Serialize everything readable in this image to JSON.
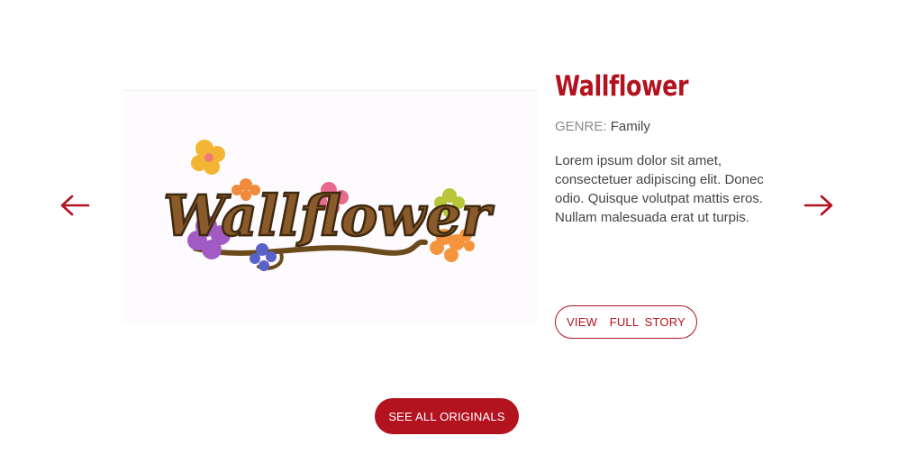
{
  "carousel": {
    "prev_icon": "arrow-left-icon",
    "next_icon": "arrow-right-icon"
  },
  "story": {
    "image_logo_text": "Wallflower",
    "title": "Wallflower",
    "genre_label": "GENRE:",
    "genre_value": "Family",
    "description": "Lorem ipsum dolor sit amet, consectetuer adipiscing elit. Donec odio. Quisque volutpat mattis eros. Nullam malesuada erat ut turpis.",
    "cta_label": "VIEW  FULL STORY"
  },
  "footer": {
    "see_all_label": "SEE ALL ORIGINALS"
  },
  "colors": {
    "brand_red": "#b3121f",
    "text": "#444444",
    "muted": "#8a8a8a"
  }
}
